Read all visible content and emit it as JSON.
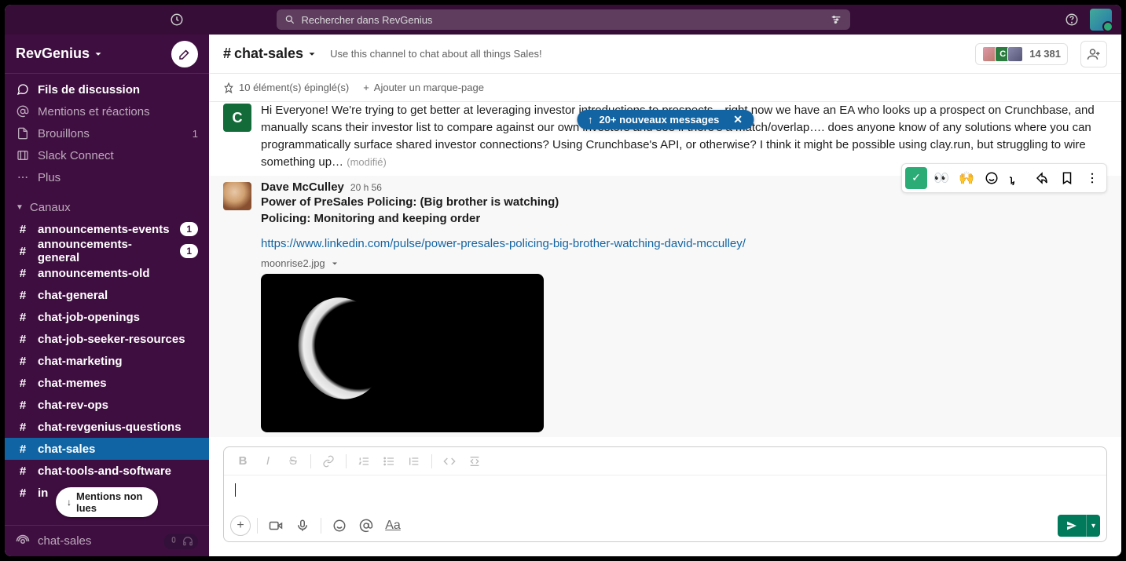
{
  "titlebar": {
    "search_placeholder": "Rechercher dans RevGenius"
  },
  "workspace": {
    "name": "RevGenius"
  },
  "nav": {
    "threads": "Fils de discussion",
    "mentions": "Mentions et réactions",
    "drafts": "Brouillons",
    "drafts_count": "1",
    "connect": "Slack Connect",
    "more": "Plus"
  },
  "sections": {
    "channels": "Canaux"
  },
  "channels": [
    {
      "name": "announcements-events",
      "unread": true,
      "badge": "1",
      "white": true
    },
    {
      "name": "announcements-general",
      "unread": true,
      "badge": "1",
      "white": true
    },
    {
      "name": "announcements-old",
      "unread": true
    },
    {
      "name": "chat-general",
      "unread": true
    },
    {
      "name": "chat-job-openings",
      "unread": true
    },
    {
      "name": "chat-job-seeker-resources",
      "unread": true
    },
    {
      "name": "chat-marketing",
      "unread": true
    },
    {
      "name": "chat-memes",
      "unread": true
    },
    {
      "name": "chat-rev-ops",
      "unread": true
    },
    {
      "name": "chat-revgenius-questions",
      "unread": true
    },
    {
      "name": "chat-sales",
      "unread": true,
      "active": true
    },
    {
      "name": "chat-tools-and-software",
      "unread": true
    },
    {
      "name": "in",
      "unread": true
    }
  ],
  "unread_pill": "Mentions non lues",
  "sidebar_footer": {
    "channel": "chat-sales"
  },
  "header": {
    "channel": "chat-sales",
    "description": "Use this channel to chat about all things Sales!",
    "member_count": "14 381",
    "av2_initial": "C"
  },
  "subheader": {
    "pinned": "10 élément(s) épinglé(s)",
    "bookmark": "Ajouter un marque-page"
  },
  "new_messages": "20+ nouveaux messages",
  "msg1": {
    "avatar_initial": "C",
    "text": "Hi Everyone! We're trying to get better at leveraging investor introductions to prospects…right now we have an EA who looks up a prospect on Crunchbase, and manually scans their investor list to compare against our own investors and see if there's a match/overlap…. does anyone know of any solutions where you can programmatically surface shared investor connections? Using Crunchbase's API, or otherwise? I think it might be possible using clay.run, but struggling to wire something up…",
    "edited": "(modifié)"
  },
  "msg2": {
    "author": "Dave McCulley",
    "time": "20 h 56",
    "line1": "Power of PreSales Policing: (Big brother is watching)",
    "line2": "Policing: Monitoring and keeping order",
    "link": "https://www.linkedin.com/pulse/power-presales-policing-big-brother-watching-david-mcculley/",
    "file": "moonrise2.jpg"
  },
  "reactions": {
    "check": "✓",
    "eyes": "👀",
    "raised": "🙌"
  },
  "format_buttons": {
    "bold": "B",
    "italic": "I",
    "strike": "S"
  },
  "aa_label": "Aa"
}
